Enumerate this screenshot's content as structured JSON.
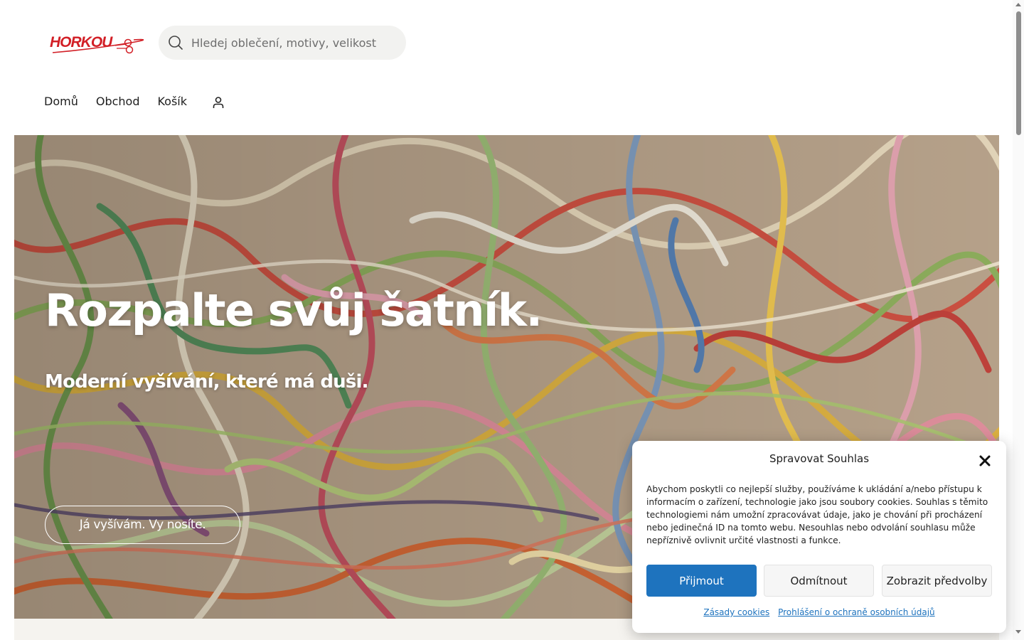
{
  "brand": {
    "logo_text": "HORKOU"
  },
  "search": {
    "placeholder": "Hledej oblečení, motivy, velikost"
  },
  "nav": {
    "items": [
      "Domů",
      "Obchod",
      "Košík"
    ]
  },
  "hero": {
    "title": "Rozpalte svůj šatník.",
    "subtitle": "Moderní vyšívání, které má duši.",
    "button_label": "Já vyšívám. Vy nosíte."
  },
  "cookie": {
    "title": "Spravovat Souhlas",
    "text": "Abychom poskytli co nejlepší služby, používáme k ukládání a/nebo přístupu k informacím o zařízení, technologie jako jsou soubory cookies. Souhlas s těmito technologiemi nám umožní zpracovávat údaje, jako je chování při procházení nebo jedinečná ID na tomto webu. Nesouhlas nebo odvolání souhlasu může nepříznivě ovlivnit určité vlastnosti a funkce.",
    "accept_label": "Přijmout",
    "deny_label": "Odmítnout",
    "prefs_label": "Zobrazit předvolby",
    "links": [
      "Zásady cookies",
      "Prohlášení o ochraně osobních údajů"
    ]
  },
  "colors": {
    "accent": "#1e73be",
    "logo_red": "#d21f26",
    "search_bg": "#f2f2f0"
  },
  "icons": {
    "search": "search-icon",
    "account": "user-icon",
    "close": "close-icon"
  }
}
